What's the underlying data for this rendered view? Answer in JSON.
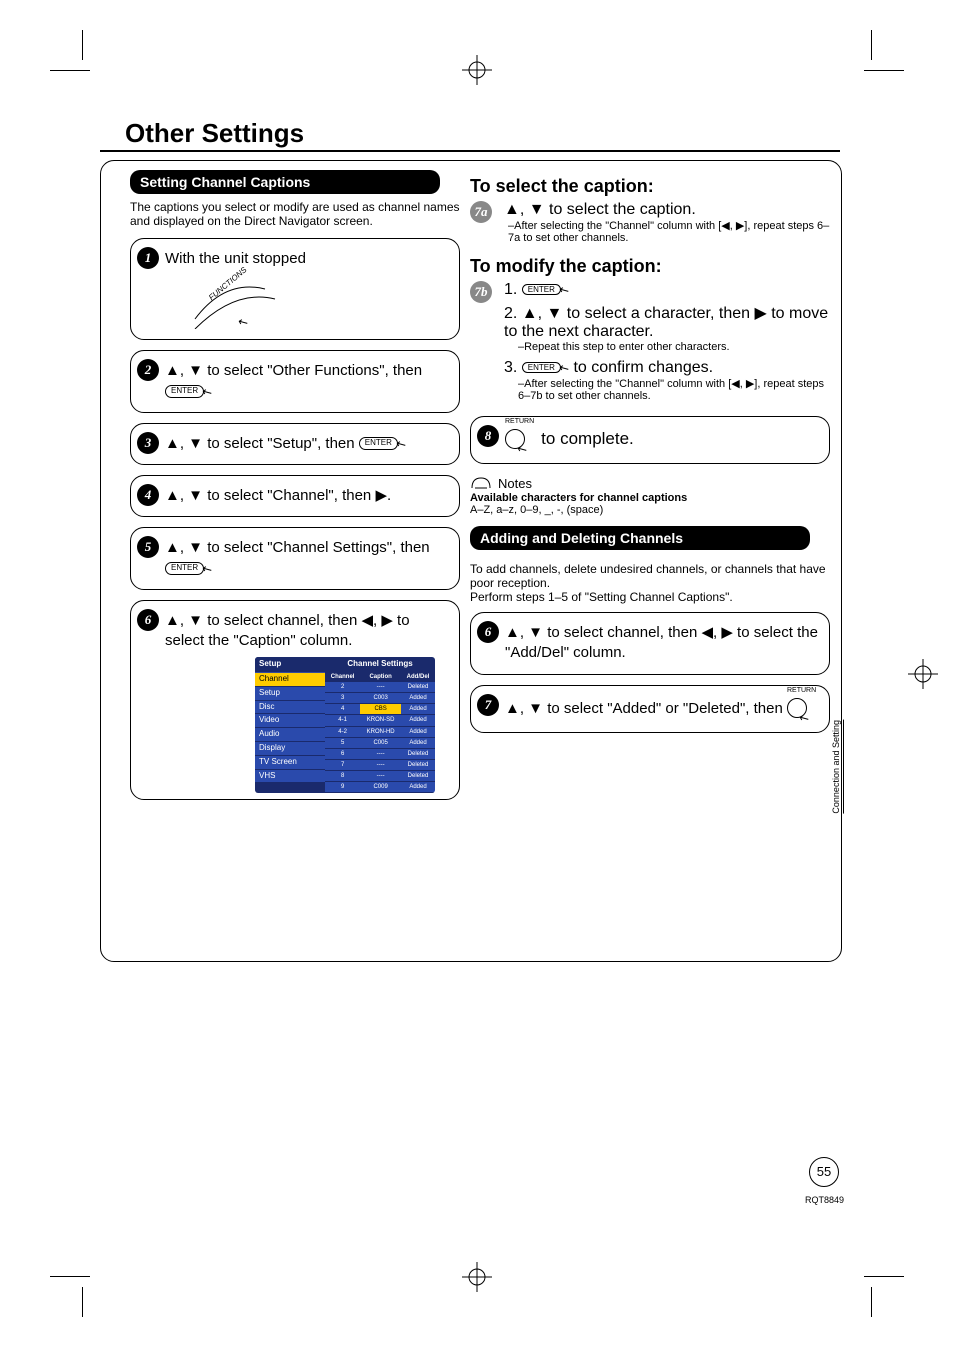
{
  "title": "Other Settings",
  "left": {
    "pill1": "Setting Channel Captions",
    "intro": "The captions you select or modify are used as channel names and displayed on the Direct Navigator screen.",
    "step1": "With the unit stopped",
    "functions_label": "FUNCTIONS",
    "step2_a": "▲, ▼ to select \"Other Functions\", then ",
    "step3_a": "▲, ▼ to select \"Setup\", then ",
    "step4": "▲, ▼ to select \"Channel\", then ▶.",
    "step5_a": "▲, ▼ to select \"Channel Settings\", then ",
    "step6": "▲, ▼ to select channel, then ◀, ▶ to select the \"Caption\" column.",
    "enter": "ENTER"
  },
  "setup_menu": {
    "title": "Setup",
    "items": [
      "Channel",
      "Setup",
      "Disc",
      "Video",
      "Audio",
      "Display",
      "TV Screen",
      "VHS"
    ],
    "panel_title": "Channel Settings",
    "cols": [
      "Channel",
      "Caption",
      "Add/Del"
    ],
    "rows": [
      {
        "ch": "2",
        "cap": "----",
        "ad": "Deleted",
        "hl": false
      },
      {
        "ch": "3",
        "cap": "C003",
        "ad": "Added",
        "hl": false
      },
      {
        "ch": "4",
        "cap": "CBS",
        "ad": "Added",
        "hl": true
      },
      {
        "ch": "4-1",
        "cap": "KRON-SD",
        "ad": "Added",
        "hl": false
      },
      {
        "ch": "4-2",
        "cap": "KRON-HD",
        "ad": "Added",
        "hl": false
      },
      {
        "ch": "5",
        "cap": "C005",
        "ad": "Added",
        "hl": false
      },
      {
        "ch": "6",
        "cap": "----",
        "ad": "Deleted",
        "hl": false
      },
      {
        "ch": "7",
        "cap": "----",
        "ad": "Deleted",
        "hl": false
      },
      {
        "ch": "8",
        "cap": "----",
        "ad": "Deleted",
        "hl": false
      },
      {
        "ch": "9",
        "cap": "C009",
        "ad": "Added",
        "hl": false
      }
    ]
  },
  "right": {
    "select_h": "To select the caption:",
    "s7a": "▲, ▼ to select the caption.",
    "s7a_note": "–After selecting the \"Channel\" column with [◀, ▶], repeat steps 6–7a to set other channels.",
    "modify_h": "To modify the caption:",
    "s7b_1": "1.",
    "s7b_2": "2. ▲, ▼ to select a character, then ▶ to move to the next character.",
    "s7b_2_note": "–Repeat this step to enter other characters.",
    "s7b_3_a": "3.",
    "s7b_3_b": " to confirm changes.",
    "s7b_3_note": "–After selecting the \"Channel\" column with [◀, ▶], repeat steps 6–7b to set other channels.",
    "s8": " to complete.",
    "return": "RETURN",
    "notes": "Notes",
    "notes_bold": "Available characters for channel captions",
    "notes_line": "A–Z, a–z, 0–9, _, -, (space)",
    "pill2": "Adding and Deleting Channels",
    "add_intro1": "To add channels, delete undesired channels, or channels that have poor reception.",
    "add_intro2": "Perform steps 1–5 of \"Setting Channel Captions\".",
    "add6": "▲, ▼ to select channel, then ◀, ▶ to select the \"Add/Del\" column.",
    "add7_a": "▲, ▼ to select \"Added\" or \"Deleted\", then "
  },
  "side_tab": "Connection and Setting",
  "page_num": "55",
  "doc_id": "RQT8849"
}
